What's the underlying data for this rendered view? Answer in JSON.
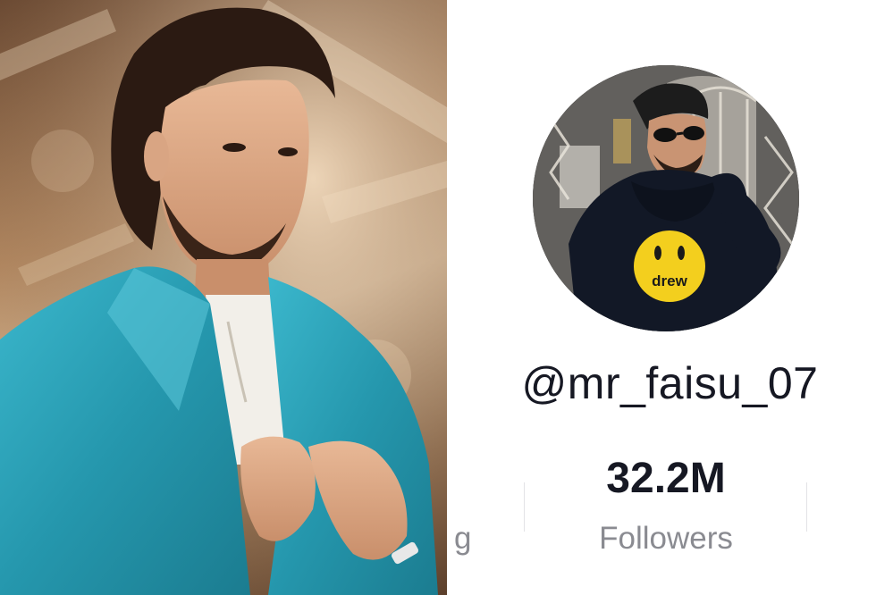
{
  "profile": {
    "username": "@mr_faisu_07",
    "stats": {
      "followers_count": "32.2M",
      "followers_label": "Followers",
      "previous_label_fragment": "g"
    },
    "avatar": {
      "hoodie_text": "drew"
    }
  },
  "colors": {
    "text_primary": "#161823",
    "text_secondary": "#8a8b91",
    "divider": "#e3e3e6",
    "blazer": "#2aa3b8",
    "smiley": "#f3cf1e"
  },
  "icons": [
    "smiley-icon"
  ]
}
